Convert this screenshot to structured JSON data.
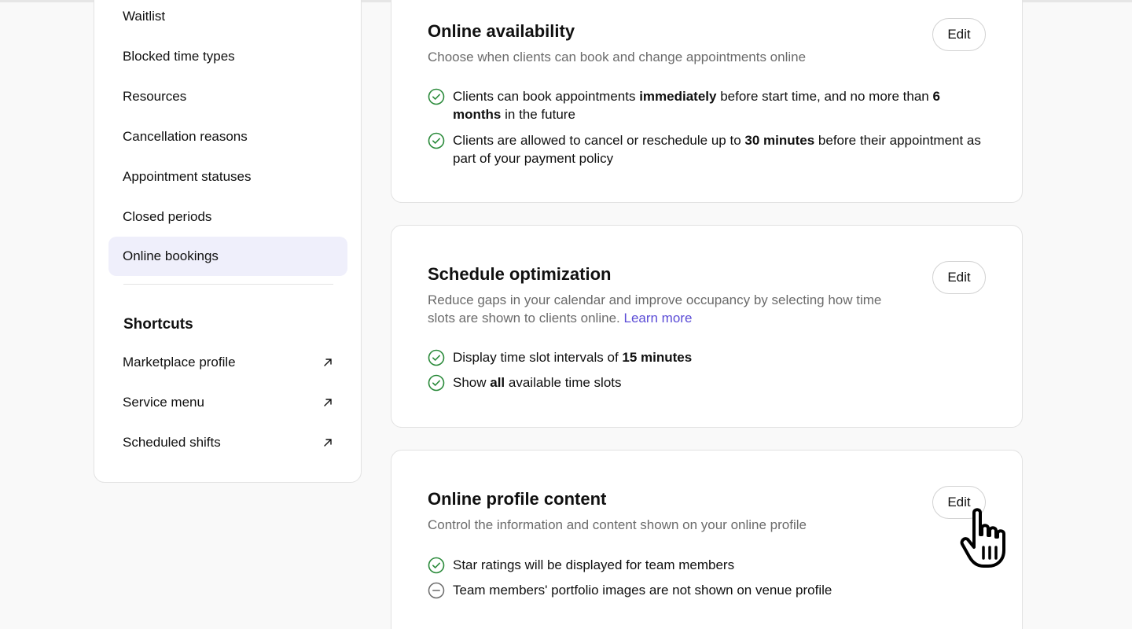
{
  "sidebar": {
    "items": [
      {
        "label": "Waitlist"
      },
      {
        "label": "Blocked time types"
      },
      {
        "label": "Resources"
      },
      {
        "label": "Cancellation reasons"
      },
      {
        "label": "Appointment statuses"
      },
      {
        "label": "Closed periods"
      },
      {
        "label": "Online bookings",
        "active": true
      }
    ],
    "shortcuts_title": "Shortcuts",
    "shortcuts": [
      {
        "label": "Marketplace profile",
        "icon": "arrow-up-right-icon"
      },
      {
        "label": "Service menu",
        "icon": "arrow-up-right-icon"
      },
      {
        "label": "Scheduled shifts",
        "icon": "arrow-up-right-icon"
      }
    ]
  },
  "cards": [
    {
      "title": "Online availability",
      "description": "Choose when clients can book and change appointments online",
      "edit_label": "Edit",
      "items": [
        {
          "status": "check",
          "t1": "Clients can book appointments ",
          "b1": "immediately",
          "t2": " before start time, and no more than ",
          "b2": "6 months",
          "t3": " in the future"
        },
        {
          "status": "check",
          "t1": "Clients are allowed to cancel or reschedule up to ",
          "b1": "30 minutes",
          "t2": " before their appointment as part of your payment policy"
        }
      ]
    },
    {
      "title": "Schedule optimization",
      "description": "Reduce gaps in your calendar and improve occupancy by selecting how time slots are shown to clients online.",
      "link_label": "Learn more",
      "edit_label": "Edit",
      "items": [
        {
          "status": "check",
          "t1": "Display time slot intervals of ",
          "b1": "15 minutes"
        },
        {
          "status": "check",
          "t1": "Show ",
          "b1": "all",
          "t2": " available time slots"
        }
      ]
    },
    {
      "title": "Online profile content",
      "description": "Control the information and content shown on your online profile",
      "edit_label": "Edit",
      "items": [
        {
          "status": "check",
          "t1": "Star ratings will be displayed for team members"
        },
        {
          "status": "minus",
          "t1": "Team members' portfolio images are not shown on venue profile"
        }
      ]
    }
  ],
  "colors": {
    "check": "#2a8a3a",
    "minus": "#6b6b6b",
    "link": "#5a4bd6",
    "active_bg": "#efeffb"
  }
}
